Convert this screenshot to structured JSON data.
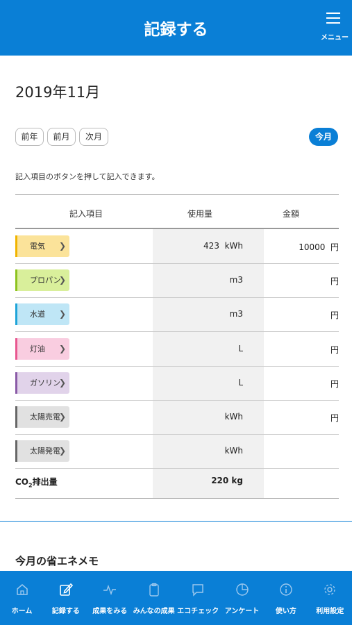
{
  "header": {
    "title": "記録する",
    "menu_label": "メニュー"
  },
  "month": {
    "title": "2019年11月",
    "buttons": [
      "前年",
      "前月",
      "次月"
    ],
    "today_label": "今月"
  },
  "instruction": "記入項目のボタンを押して記入できます。",
  "table": {
    "headers": [
      "記入項目",
      "使用量",
      "金額"
    ],
    "rows": [
      {
        "label": "電気",
        "usage": "423  kWh",
        "amount": "10000  円",
        "bg": "#fbe39a",
        "bar": "#f0b400"
      },
      {
        "label": "プロパン",
        "usage": "m3",
        "amount": "円",
        "bg": "#d9ef9b",
        "bar": "#8dc21f"
      },
      {
        "label": "水道",
        "usage": "m3",
        "amount": "円",
        "bg": "#bfe6f6",
        "bar": "#1fa4d8"
      },
      {
        "label": "灯油",
        "usage": "L",
        "amount": "円",
        "bg": "#f9cde0",
        "bar": "#e8578f"
      },
      {
        "label": "ガソリン",
        "usage": "L",
        "amount": "円",
        "bg": "#e1d3ea",
        "bar": "#8a5aa6"
      },
      {
        "label": "太陽売電",
        "usage": "kWh",
        "amount": "円",
        "bg": "#e1e1e1",
        "bar": "#666666"
      },
      {
        "label": "太陽発電",
        "usage": "kWh",
        "amount": "",
        "bg": "#e1e1e1",
        "bar": "#666666"
      }
    ],
    "co2": {
      "label_prefix": "CO",
      "label_sub": "2",
      "label_suffix": "排出量",
      "value": "220  kg"
    }
  },
  "memo_title": "今月の省エネメモ",
  "bottom_nav": [
    {
      "label": "ホーム",
      "icon": "home-icon"
    },
    {
      "label": "記録する",
      "icon": "edit-icon"
    },
    {
      "label": "成果をみる",
      "icon": "pulse-icon"
    },
    {
      "label": "みんなの成果",
      "icon": "clipboard-icon"
    },
    {
      "label": "エコチェック",
      "icon": "chat-icon"
    },
    {
      "label": "アンケート",
      "icon": "pie-icon"
    },
    {
      "label": "使い方",
      "icon": "info-icon"
    },
    {
      "label": "利用設定",
      "icon": "gear-icon"
    }
  ],
  "colors": {
    "brand": "#0a7fd6",
    "nav_inactive_icon": "#9cc8ee"
  }
}
